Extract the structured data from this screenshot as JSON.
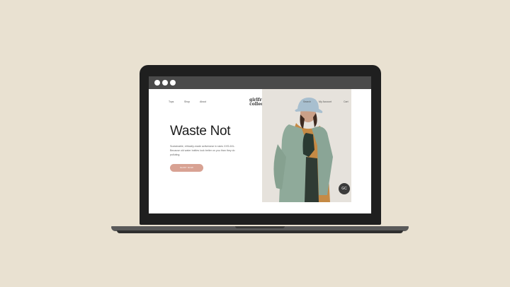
{
  "nav": {
    "items": [
      "Tops",
      "Shop",
      "About"
    ],
    "right_items": [
      "Search",
      "My Account",
      "Cart"
    ]
  },
  "brand": {
    "logo_line1": "girlfriend",
    "logo_line2": "collective"
  },
  "hero": {
    "headline": "Waste Not",
    "body": "Sustainable, ethically-made activewear in sizes XXS-6XL. Because old water bottles look better on you than they do polluting.",
    "cta_label": "SHOP NOW"
  },
  "badge": {
    "label": "GC"
  },
  "colors": {
    "background": "#e9e1d1",
    "browser_bar": "#4a4a4a",
    "cta": "#d8a293",
    "jacket": "#8faa9a"
  }
}
